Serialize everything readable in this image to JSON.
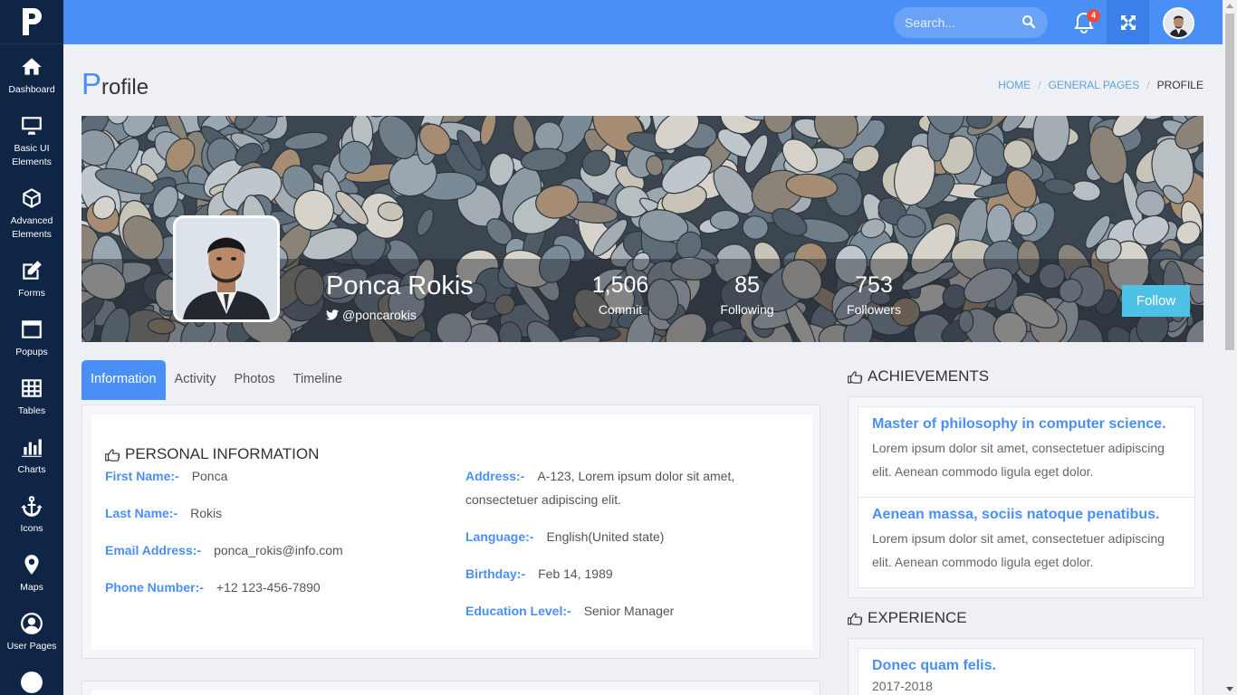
{
  "sidebar": {
    "items": [
      {
        "label": "Dashboard",
        "icon": "home-icon"
      },
      {
        "label": "Basic UI Elements",
        "icon": "monitor-icon"
      },
      {
        "label": "Advanced Elements",
        "icon": "cube-icon"
      },
      {
        "label": "Forms",
        "icon": "edit-icon"
      },
      {
        "label": "Popups",
        "icon": "window-icon"
      },
      {
        "label": "Tables",
        "icon": "table-icon"
      },
      {
        "label": "Charts",
        "icon": "bar-chart-icon"
      },
      {
        "label": "Icons",
        "icon": "anchor-icon"
      },
      {
        "label": "Maps",
        "icon": "map-pin-icon"
      },
      {
        "label": "User Pages",
        "icon": "user-circle-icon"
      }
    ]
  },
  "topbar": {
    "search_placeholder": "Search...",
    "notification_count": "4"
  },
  "page": {
    "title_first": "P",
    "title_rest": "rofile",
    "breadcrumb": [
      "HOME",
      "GENERAL PAGES",
      "PROFILE"
    ]
  },
  "profile": {
    "name": "Ponca Rokis",
    "handle": "@poncarokis",
    "stats": [
      {
        "value": "1,506",
        "label": "Commit"
      },
      {
        "value": "85",
        "label": "Following"
      },
      {
        "value": "753",
        "label": "Followers"
      }
    ],
    "follow_label": "Follow"
  },
  "tabs": [
    "Information",
    "Activity",
    "Photos",
    "Timeline"
  ],
  "personal": {
    "title": "PERSONAL INFORMATION",
    "first_name": {
      "key": "First Name:-",
      "value": "Ponca"
    },
    "last_name": {
      "key": "Last Name:-",
      "value": "Rokis"
    },
    "email": {
      "key": "Email Address:-",
      "value": "ponca_rokis@info.com"
    },
    "phone": {
      "key": "Phone Number:-",
      "value": "+12 123-456-7890"
    },
    "address": {
      "key": "Address:-",
      "value": "A-123, Lorem ipsum dolor sit amet, consectetuer adipiscing elit."
    },
    "language": {
      "key": "Language:-",
      "value": "English(United state)"
    },
    "birthday": {
      "key": "Birthday:-",
      "value": "Feb 14, 1989"
    },
    "education": {
      "key": "Education Level:-",
      "value": "Senior Manager"
    }
  },
  "achievements": {
    "title": "ACHIEVEMENTS",
    "items": [
      {
        "title": "Master of philosophy in computer science.",
        "text": "Lorem ipsum dolor sit amet, consectetuer adipiscing elit. Aenean commodo ligula eget dolor."
      },
      {
        "title": "Aenean massa, sociis natoque penatibus.",
        "text": "Lorem ipsum dolor sit amet, consectetuer adipiscing elit. Aenean commodo ligula eget dolor."
      }
    ]
  },
  "experience": {
    "title": "EXPERIENCE",
    "items": [
      {
        "title": "Donec quam felis.",
        "period": "2017-2018"
      }
    ]
  },
  "colors": {
    "sidebar": "#0f2545",
    "topbar": "#4a8ff5",
    "accent": "#4a8ff5",
    "follow": "#4ec1e6",
    "badge": "#e94b3c"
  }
}
